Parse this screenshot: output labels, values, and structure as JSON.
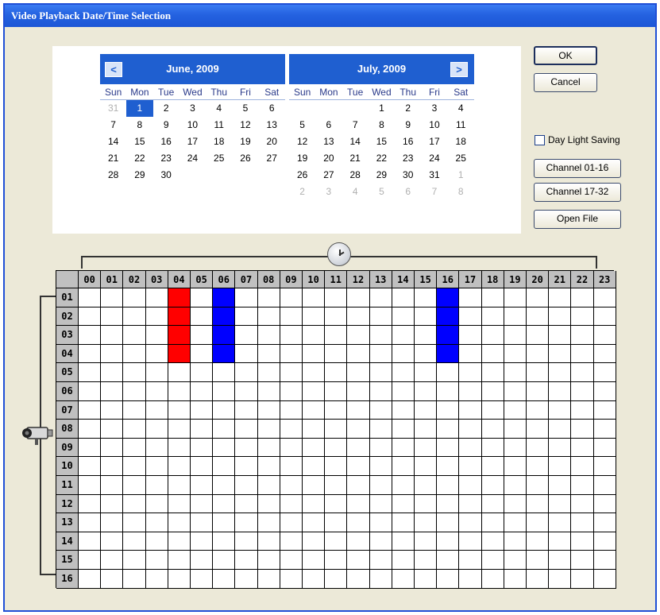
{
  "window": {
    "title": "Video Playback Date/Time Selection"
  },
  "calendar": {
    "days_of_week": [
      "Sun",
      "Mon",
      "Tue",
      "Wed",
      "Thu",
      "Fri",
      "Sat"
    ],
    "months": [
      {
        "title": "June, 2009",
        "nav": "<",
        "weeks": [
          [
            {
              "d": "31",
              "o": true
            },
            {
              "d": "1",
              "sel": true
            },
            {
              "d": "2"
            },
            {
              "d": "3"
            },
            {
              "d": "4"
            },
            {
              "d": "5"
            },
            {
              "d": "6"
            }
          ],
          [
            {
              "d": "7"
            },
            {
              "d": "8"
            },
            {
              "d": "9"
            },
            {
              "d": "10"
            },
            {
              "d": "11"
            },
            {
              "d": "12"
            },
            {
              "d": "13"
            }
          ],
          [
            {
              "d": "14"
            },
            {
              "d": "15"
            },
            {
              "d": "16"
            },
            {
              "d": "17"
            },
            {
              "d": "18"
            },
            {
              "d": "19"
            },
            {
              "d": "20"
            }
          ],
          [
            {
              "d": "21"
            },
            {
              "d": "22"
            },
            {
              "d": "23"
            },
            {
              "d": "24"
            },
            {
              "d": "25"
            },
            {
              "d": "26"
            },
            {
              "d": "27"
            }
          ],
          [
            {
              "d": "28"
            },
            {
              "d": "29"
            },
            {
              "d": "30"
            },
            {
              "d": ""
            },
            {
              "d": ""
            },
            {
              "d": ""
            },
            {
              "d": ""
            }
          ],
          [
            {
              "d": ""
            },
            {
              "d": ""
            },
            {
              "d": ""
            },
            {
              "d": ""
            },
            {
              "d": ""
            },
            {
              "d": ""
            },
            {
              "d": ""
            }
          ]
        ]
      },
      {
        "title": "July, 2009",
        "nav": ">",
        "weeks": [
          [
            {
              "d": ""
            },
            {
              "d": ""
            },
            {
              "d": ""
            },
            {
              "d": "1"
            },
            {
              "d": "2"
            },
            {
              "d": "3"
            },
            {
              "d": "4"
            }
          ],
          [
            {
              "d": "5"
            },
            {
              "d": "6"
            },
            {
              "d": "7"
            },
            {
              "d": "8"
            },
            {
              "d": "9"
            },
            {
              "d": "10"
            },
            {
              "d": "11"
            }
          ],
          [
            {
              "d": "12"
            },
            {
              "d": "13"
            },
            {
              "d": "14"
            },
            {
              "d": "15"
            },
            {
              "d": "16"
            },
            {
              "d": "17"
            },
            {
              "d": "18"
            }
          ],
          [
            {
              "d": "19"
            },
            {
              "d": "20"
            },
            {
              "d": "21"
            },
            {
              "d": "22"
            },
            {
              "d": "23"
            },
            {
              "d": "24"
            },
            {
              "d": "25"
            }
          ],
          [
            {
              "d": "26"
            },
            {
              "d": "27"
            },
            {
              "d": "28"
            },
            {
              "d": "29"
            },
            {
              "d": "30"
            },
            {
              "d": "31"
            },
            {
              "d": "1",
              "o": true
            }
          ],
          [
            {
              "d": "2",
              "o": true
            },
            {
              "d": "3",
              "o": true
            },
            {
              "d": "4",
              "o": true
            },
            {
              "d": "5",
              "o": true
            },
            {
              "d": "6",
              "o": true
            },
            {
              "d": "7",
              "o": true
            },
            {
              "d": "8",
              "o": true
            }
          ]
        ]
      }
    ]
  },
  "buttons": {
    "ok": "OK",
    "cancel": "Cancel",
    "daylight_saving": "Day Light Saving",
    "channel_1_16": "Channel 01-16",
    "channel_17_32": "Channel 17-32",
    "open_file": "Open File"
  },
  "timeline": {
    "hours": [
      "00",
      "01",
      "02",
      "03",
      "04",
      "05",
      "06",
      "07",
      "08",
      "09",
      "10",
      "11",
      "12",
      "13",
      "14",
      "15",
      "16",
      "17",
      "18",
      "19",
      "20",
      "21",
      "22",
      "23"
    ],
    "channels": [
      "01",
      "02",
      "03",
      "04",
      "05",
      "06",
      "07",
      "08",
      "09",
      "10",
      "11",
      "12",
      "13",
      "14",
      "15",
      "16"
    ],
    "recordings": [
      {
        "channels": [
          "01",
          "02",
          "03",
          "04"
        ],
        "hour": "04",
        "color": "#ff0000"
      },
      {
        "channels": [
          "01",
          "02",
          "03",
          "04"
        ],
        "hour": "06",
        "color": "#0000ff"
      },
      {
        "channels": [
          "01",
          "02",
          "03",
          "04"
        ],
        "hour": "16",
        "color": "#0000ff"
      }
    ],
    "icons": {
      "time": "clock-icon",
      "channel": "camera-icon"
    }
  },
  "colors": {
    "title_bar": "#1c56d6",
    "calendar_header": "#1f5fd0",
    "selected_day": "#1f5fd0"
  }
}
